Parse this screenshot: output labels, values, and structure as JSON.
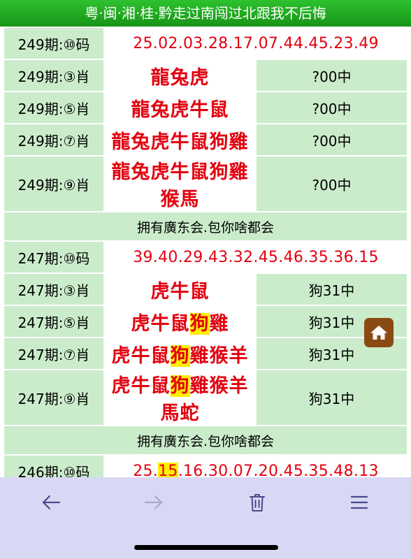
{
  "header": {
    "title": "粤·闽·湘·桂·黔走过南闯过北跟我不后悔"
  },
  "rows": {
    "r0": {
      "label": "249期:⑩码",
      "value": "25.02.03.28.17.07.44.45.23.49"
    },
    "r1": {
      "label": "249期:③肖",
      "value": "龍兔虎",
      "result": "?00中"
    },
    "r2": {
      "label": "249期:⑤肖",
      "value": "龍兔虎牛鼠",
      "result": "?00中"
    },
    "r3": {
      "label": "249期:⑦肖",
      "value": "龍兔虎牛鼠狗雞",
      "result": "?00中"
    },
    "r4": {
      "label": "249期:⑨肖",
      "value": "龍兔虎牛鼠狗雞猴馬",
      "result": "?00中"
    },
    "ad1": "拥有廣东会.包你啥都会",
    "r5": {
      "label": "247期:⑩码",
      "value": "39.40.29.43.32.45.46.35.36.15"
    },
    "r6": {
      "label": "247期:③肖",
      "value": "虎牛鼠",
      "result": "狗31中"
    },
    "r7": {
      "label": "247期:⑤肖",
      "pre": "虎牛鼠",
      "hit": "狗",
      "post": "雞",
      "result": "狗31中"
    },
    "r8": {
      "label": "247期:⑦肖",
      "pre": "虎牛鼠",
      "hit": "狗",
      "post": "雞猴羊",
      "result": "狗31中"
    },
    "r9": {
      "label": "247期:⑨肖",
      "pre": "虎牛鼠",
      "hit": "狗",
      "post": "雞猴羊馬蛇",
      "result": "狗31中"
    },
    "ad2": "拥有廣东会.包你啥都会",
    "r10": {
      "label": "246期:⑩码",
      "pre": "25.",
      "hit": "15",
      "post": ".16.30.07.20.45.35.48.13"
    }
  },
  "colors": {
    "header_green": "#1fa81f",
    "cell_green": "#cbeccb",
    "red_text": "#e3000f",
    "highlight": "#ffee00",
    "toolbar": "#d9d8f4",
    "home_button": "#8a4b12"
  },
  "floating": {
    "icon": "home-icon"
  },
  "toolbar": {
    "icons": [
      "back-arrow-icon",
      "forward-arrow-icon",
      "trash-icon",
      "menu-icon"
    ]
  }
}
